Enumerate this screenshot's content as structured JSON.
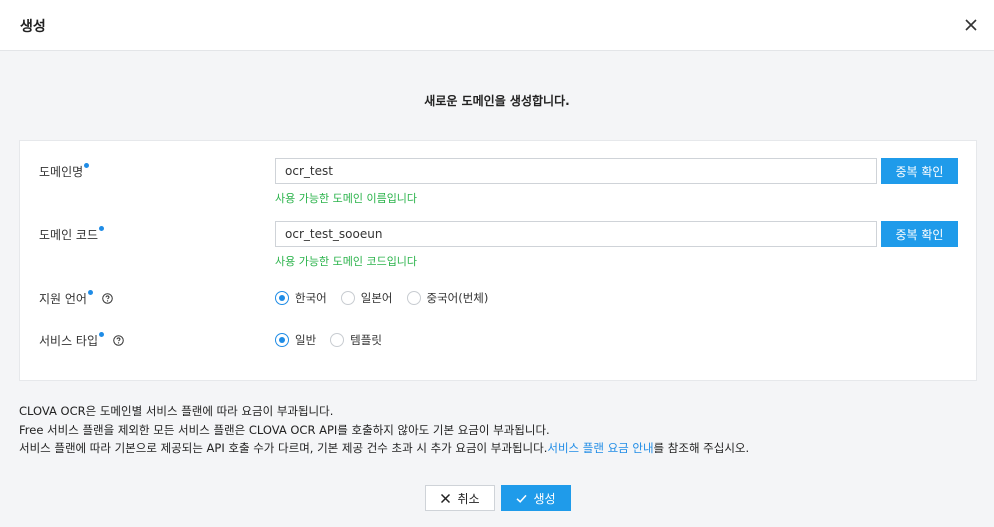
{
  "header": {
    "title": "생성"
  },
  "subtitle": "새로운 도메인을 생성합니다.",
  "form": {
    "domain_name": {
      "label": "도메인명",
      "value": "ocr_test",
      "check_button": "중복 확인",
      "message": "사용 가능한 도메인 이름입니다"
    },
    "domain_code": {
      "label": "도메인 코드",
      "value": "ocr_test_sooeun",
      "check_button": "중복 확인",
      "message": "사용 가능한 도메인 코드입니다"
    },
    "language": {
      "label": "지원 언어",
      "options": [
        "한국어",
        "일본어",
        "중국어(번체)"
      ],
      "selected": "한국어"
    },
    "service_type": {
      "label": "서비스 타입",
      "options": [
        "일반",
        "템플릿"
      ],
      "selected": "일반"
    }
  },
  "notes": {
    "line1": "CLOVA OCR은 도메인별 서비스 플랜에 따라 요금이 부과됩니다.",
    "line2": "Free 서비스 플랜을 제외한 모든 서비스 플랜은 CLOVA OCR API를 호출하지 않아도 기본 요금이 부과됩니다.",
    "line3_prefix": "서비스 플랜에 따라 기본으로 제공되는 API 호출 수가 다르며, 기본 제공 건수 초과 시 추가 요금이 부과됩니다.",
    "line3_link": "서비스 플랜 요금 안내",
    "line3_suffix": "를 참조해 주십시오."
  },
  "footer": {
    "cancel_label": "취소",
    "create_label": "생성"
  },
  "colors": {
    "accent": "#1f9bea",
    "success": "#2bb34b",
    "required_dot": "#1f8ce6"
  },
  "icons": {
    "close": "close-icon",
    "help": "help-icon",
    "cancel": "x-icon",
    "confirm": "check-icon"
  }
}
